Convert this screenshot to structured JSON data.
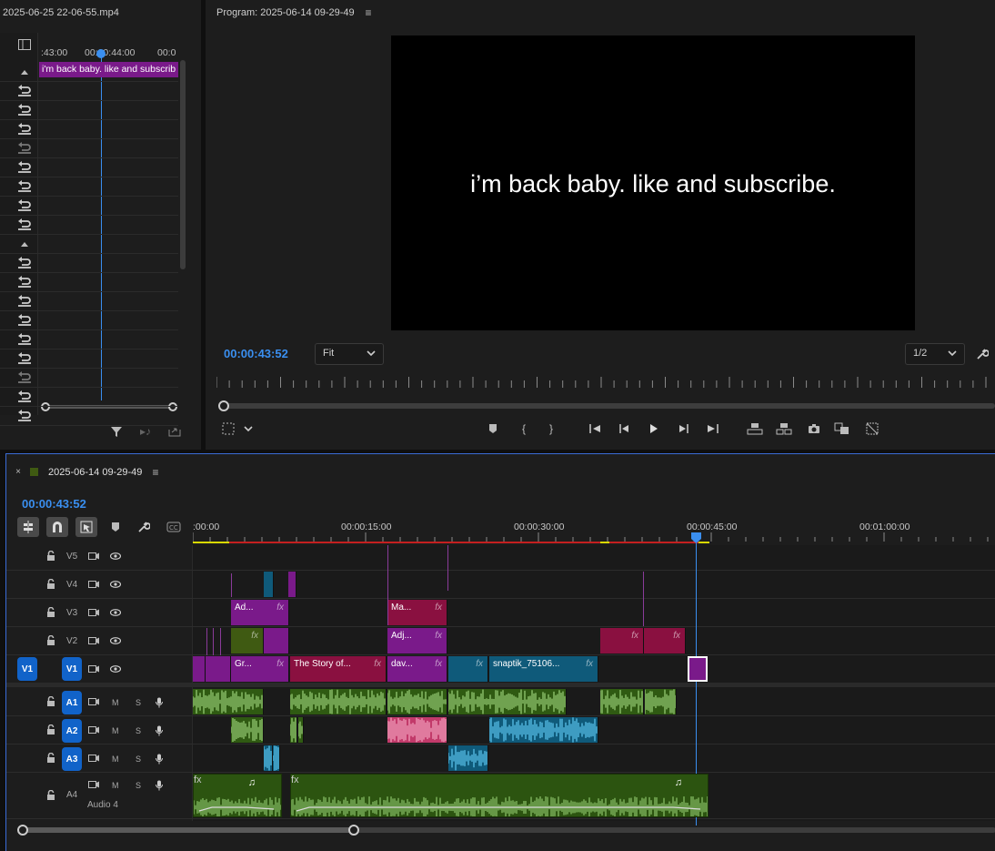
{
  "source_panel": {
    "title": "2025-06-25 22-06-55.mp4",
    "ruler_labels": [
      ":43:00",
      "00:00:44:00",
      "00:0"
    ],
    "caption_clip": "i'm back baby. like and subscrib"
  },
  "program_panel": {
    "title": "Program: 2025-06-14 09-29-49",
    "caption": "i’m back baby. like and subscribe.",
    "timecode": "00:00:43:52",
    "fit_label": "Fit",
    "resolution_label": "1/2"
  },
  "timeline": {
    "sequence_name": "2025-06-14 09-29-49",
    "timecode": "00:00:43:52",
    "ruler_labels": [
      ":00:00",
      "00:00:15:00",
      "00:00:30:00",
      "00:00:45:00",
      "00:01:00:00"
    ],
    "tracks": {
      "v5": "V5",
      "v4": "V4",
      "v3": "V3",
      "v2": "V2",
      "v1": "V1",
      "v1_source": "V1",
      "a1": "A1",
      "a2": "A2",
      "a3": "A3",
      "a4": "A4",
      "audio4_name": "Audio 4",
      "mute": "M",
      "solo": "S"
    },
    "clips": {
      "v3_ad": "Ad...",
      "v3_ma": "Ma...",
      "v2_adj": "Adj...",
      "v1_gr": "Gr...",
      "v1_story": "The Story of...",
      "v1_dav": "dav...",
      "v1_snap": "snaptik_75106...",
      "fx": "fx"
    }
  },
  "colors": {
    "accent_blue": "#3a8ff0",
    "clip_purple": "#7a1a8a",
    "clip_crimson": "#8a1040",
    "clip_teal": "#0f5a7a",
    "clip_olive": "#3f5a12",
    "audio_green": "#2f5a12"
  }
}
